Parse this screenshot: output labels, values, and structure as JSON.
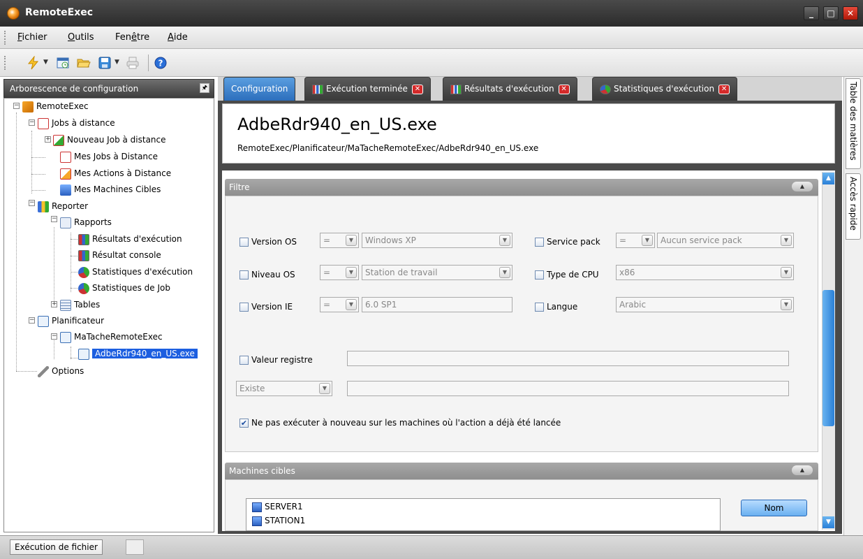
{
  "window": {
    "title": "RemoteExec",
    "minimize_label": "_",
    "maximize_label": "□",
    "close_label": "✕"
  },
  "menu": {
    "items": [
      {
        "label_pre": "",
        "label_ul": "F",
        "label_post": "ichier"
      },
      {
        "label_pre": "",
        "label_ul": "O",
        "label_post": "utils"
      },
      {
        "label_pre": "Fen",
        "label_ul": "ê",
        "label_post": "tre"
      },
      {
        "label_pre": "",
        "label_ul": "A",
        "label_post": "ide"
      }
    ]
  },
  "left_panel": {
    "title": "Arborescence de configuration",
    "pin_label": "🖈"
  },
  "tree": {
    "items": [
      {
        "label": "RemoteExec"
      },
      {
        "label": "Jobs à distance"
      },
      {
        "label": "Nouveau Job à distance"
      },
      {
        "label": "Mes Jobs à Distance"
      },
      {
        "label": "Mes Actions à Distance"
      },
      {
        "label": "Mes Machines Cibles"
      },
      {
        "label": "Reporter"
      },
      {
        "label": "Rapports"
      },
      {
        "label": "Résultats d'exécution"
      },
      {
        "label": "Résultat console"
      },
      {
        "label": "Statistiques d'exécution"
      },
      {
        "label": "Statistiques de Job"
      },
      {
        "label": "Tables"
      },
      {
        "label": "Planificateur"
      },
      {
        "label": "MaTacheRemoteExec"
      },
      {
        "label": "AdbeRdr940_en_US.exe"
      },
      {
        "label": "Options"
      }
    ]
  },
  "tabs": [
    {
      "label": "Configuration"
    },
    {
      "label": "Exécution terminée"
    },
    {
      "label": "Résultats d'exécution"
    },
    {
      "label": "Statistiques d'exécution"
    }
  ],
  "header": {
    "title": "AdbeRdr940_en_US.exe",
    "path": "RemoteExec/Planificateur/MaTacheRemoteExec/AdbeRdr940_en_US.exe"
  },
  "filter": {
    "title": "Filtre",
    "operator": "=",
    "version_os": {
      "label": "Version OS",
      "value": "Windows XP"
    },
    "service_pack": {
      "label": "Service pack",
      "value": "Aucun service pack"
    },
    "niveau_os": {
      "label": "Niveau OS",
      "value": "Station de travail"
    },
    "type_cpu": {
      "label": "Type de CPU",
      "value": "x86"
    },
    "version_ie": {
      "label": "Version IE",
      "value": "6.0 SP1"
    },
    "langue": {
      "label": "Langue",
      "value": "Arabic"
    },
    "valeur_registre": {
      "label": "Valeur registre"
    },
    "existe": {
      "value": "Existe"
    },
    "no_rerun": {
      "label": "Ne pas exécuter à nouveau sur les machines où l'action a déjà été lancée"
    }
  },
  "machines": {
    "title": "Machines cibles",
    "items": [
      "SERVER1",
      "STATION1"
    ],
    "nom_button": "Nom"
  },
  "side_tabs": {
    "toc": "Table des matières",
    "quick": "Accès rapide"
  },
  "status": {
    "text": "Exécution de fichier"
  },
  "colors": {
    "accent": "#2c6ebc",
    "selection": "#1c5ee0",
    "close": "#d42a2a"
  }
}
